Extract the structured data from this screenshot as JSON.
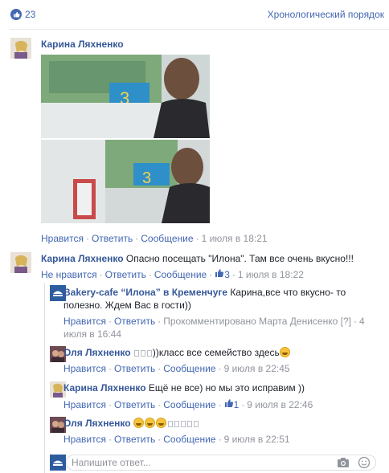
{
  "header": {
    "like_count": "23",
    "sort_label": "Хронологический порядок"
  },
  "comments": [
    {
      "author": "Карина Ляхненко",
      "like": "Нравится",
      "reply": "Ответить",
      "message": "Сообщение",
      "time": "1 июля в 18:21"
    },
    {
      "author": "Карина Ляхненко",
      "text": "Опасно посещать \"Илона\". Там все очень вкусно!!!",
      "unlike": "Не нравится",
      "reply": "Ответить",
      "message": "Сообщение",
      "reactions": "3",
      "time": "1 июля в 18:22"
    }
  ],
  "replies": [
    {
      "author": "Bakery-cafe “Илона” в Кременчуге",
      "text": "Карина,все что вкусно- то полезно. Ждем Вас в гости))",
      "like": "Нравится",
      "reply": "Ответить",
      "commented_by": "Прокомментировано Марта Денисенко",
      "commented_by_mark": "[?]",
      "time_part1": "4",
      "time_part2": "июля в 16:44"
    },
    {
      "author": "Оля Ляхненко",
      "text": "))класс все семейство здесь",
      "like": "Нравится",
      "reply": "Ответить",
      "message": "Сообщение",
      "time": "9 июля в 22:45"
    },
    {
      "author": "Карина Ляхненко",
      "text": "Ещё не все) но мы это исправим ))",
      "like": "Нравится",
      "reply": "Ответить",
      "message": "Сообщение",
      "reactions": "1",
      "time": "9 июля в 22:46"
    },
    {
      "author": "Оля Ляхненко",
      "text": "",
      "like": "Нравится",
      "reply": "Ответить",
      "message": "Сообщение",
      "time": "9 июля в 22:51"
    }
  ],
  "composer": {
    "placeholder": "Напишите ответ..."
  },
  "icons": {
    "like": "thumbs-up-icon",
    "camera": "camera-icon",
    "sticker": "smiley-icon"
  },
  "colors": {
    "link": "#4267b2",
    "name": "#365899",
    "meta": "#90949c"
  }
}
